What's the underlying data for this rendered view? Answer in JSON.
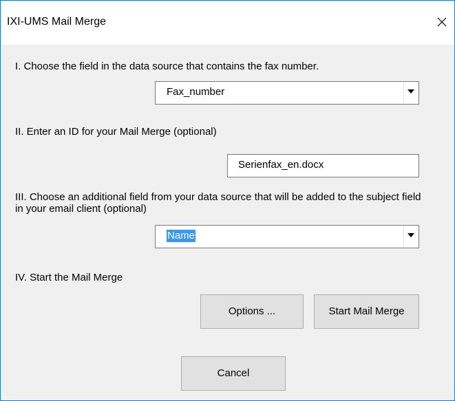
{
  "window": {
    "title": "IXI-UMS Mail Merge",
    "close_glyph": "close-icon"
  },
  "steps": {
    "step1_label": "I.  Choose the field in the data source that contains the fax number.",
    "fax_field_value": "Fax_number",
    "step2_label": "II.  Enter an ID for your Mail Merge (optional)",
    "id_field_value": "Serienfax_en.docx",
    "step3_label": "III. Choose an additional field from your data source that will be added to the subject field in your email client (optional)",
    "subject_field_value": "Name",
    "step4_label": "IV.  Start the Mail Merge"
  },
  "buttons": {
    "options": "Options ...",
    "start": "Start Mail Merge",
    "cancel": "Cancel"
  },
  "colors": {
    "window_border": "#1979ca",
    "dialog_bg": "#f0f0f0",
    "selection": "#3399ff"
  }
}
